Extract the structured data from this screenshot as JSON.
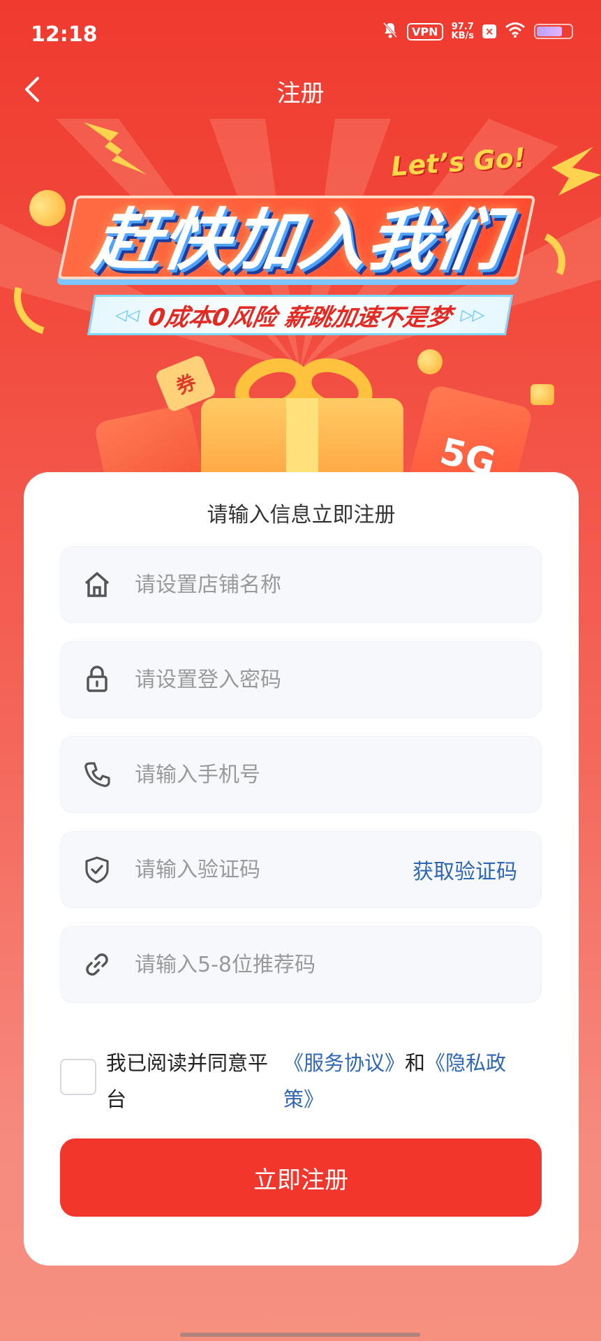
{
  "status_bar": {
    "time": "12:18",
    "vpn": "VPN",
    "net_speed_value": "97.7",
    "net_speed_unit": "KB/s",
    "battery_level": 0.75
  },
  "nav": {
    "back_icon": "chevron-left-icon",
    "title": "注册"
  },
  "banner": {
    "tagline": "Let’s Go!",
    "headline": "赶快加入我们",
    "subhead": "0成本0风险 薪跳加速不是梦",
    "coupon_text": "券",
    "card_text": "5G"
  },
  "form": {
    "title": "请输入信息立即注册",
    "fields": [
      {
        "icon": "store-icon",
        "placeholder": "请设置店铺名称",
        "value": ""
      },
      {
        "icon": "lock-icon",
        "placeholder": "请设置登入密码",
        "value": ""
      },
      {
        "icon": "phone-icon",
        "placeholder": "请输入手机号",
        "value": ""
      },
      {
        "icon": "shield-check-icon",
        "placeholder": "请输入验证码",
        "value": ""
      },
      {
        "icon": "link-icon",
        "placeholder": "请输入5-8位推荐码",
        "value": ""
      }
    ],
    "get_code_label": "获取验证码",
    "agreement": {
      "checked": false,
      "text": "我已阅读并同意平台",
      "service_link": "《服务协议》",
      "and": "和",
      "privacy_link": "《隐私政策》"
    },
    "submit_label": "立即注册"
  },
  "colors": {
    "primary": "#f3362c",
    "link": "#2f67b5",
    "field_bg": "#f6f8fc",
    "placeholder": "#9a9a9a"
  }
}
